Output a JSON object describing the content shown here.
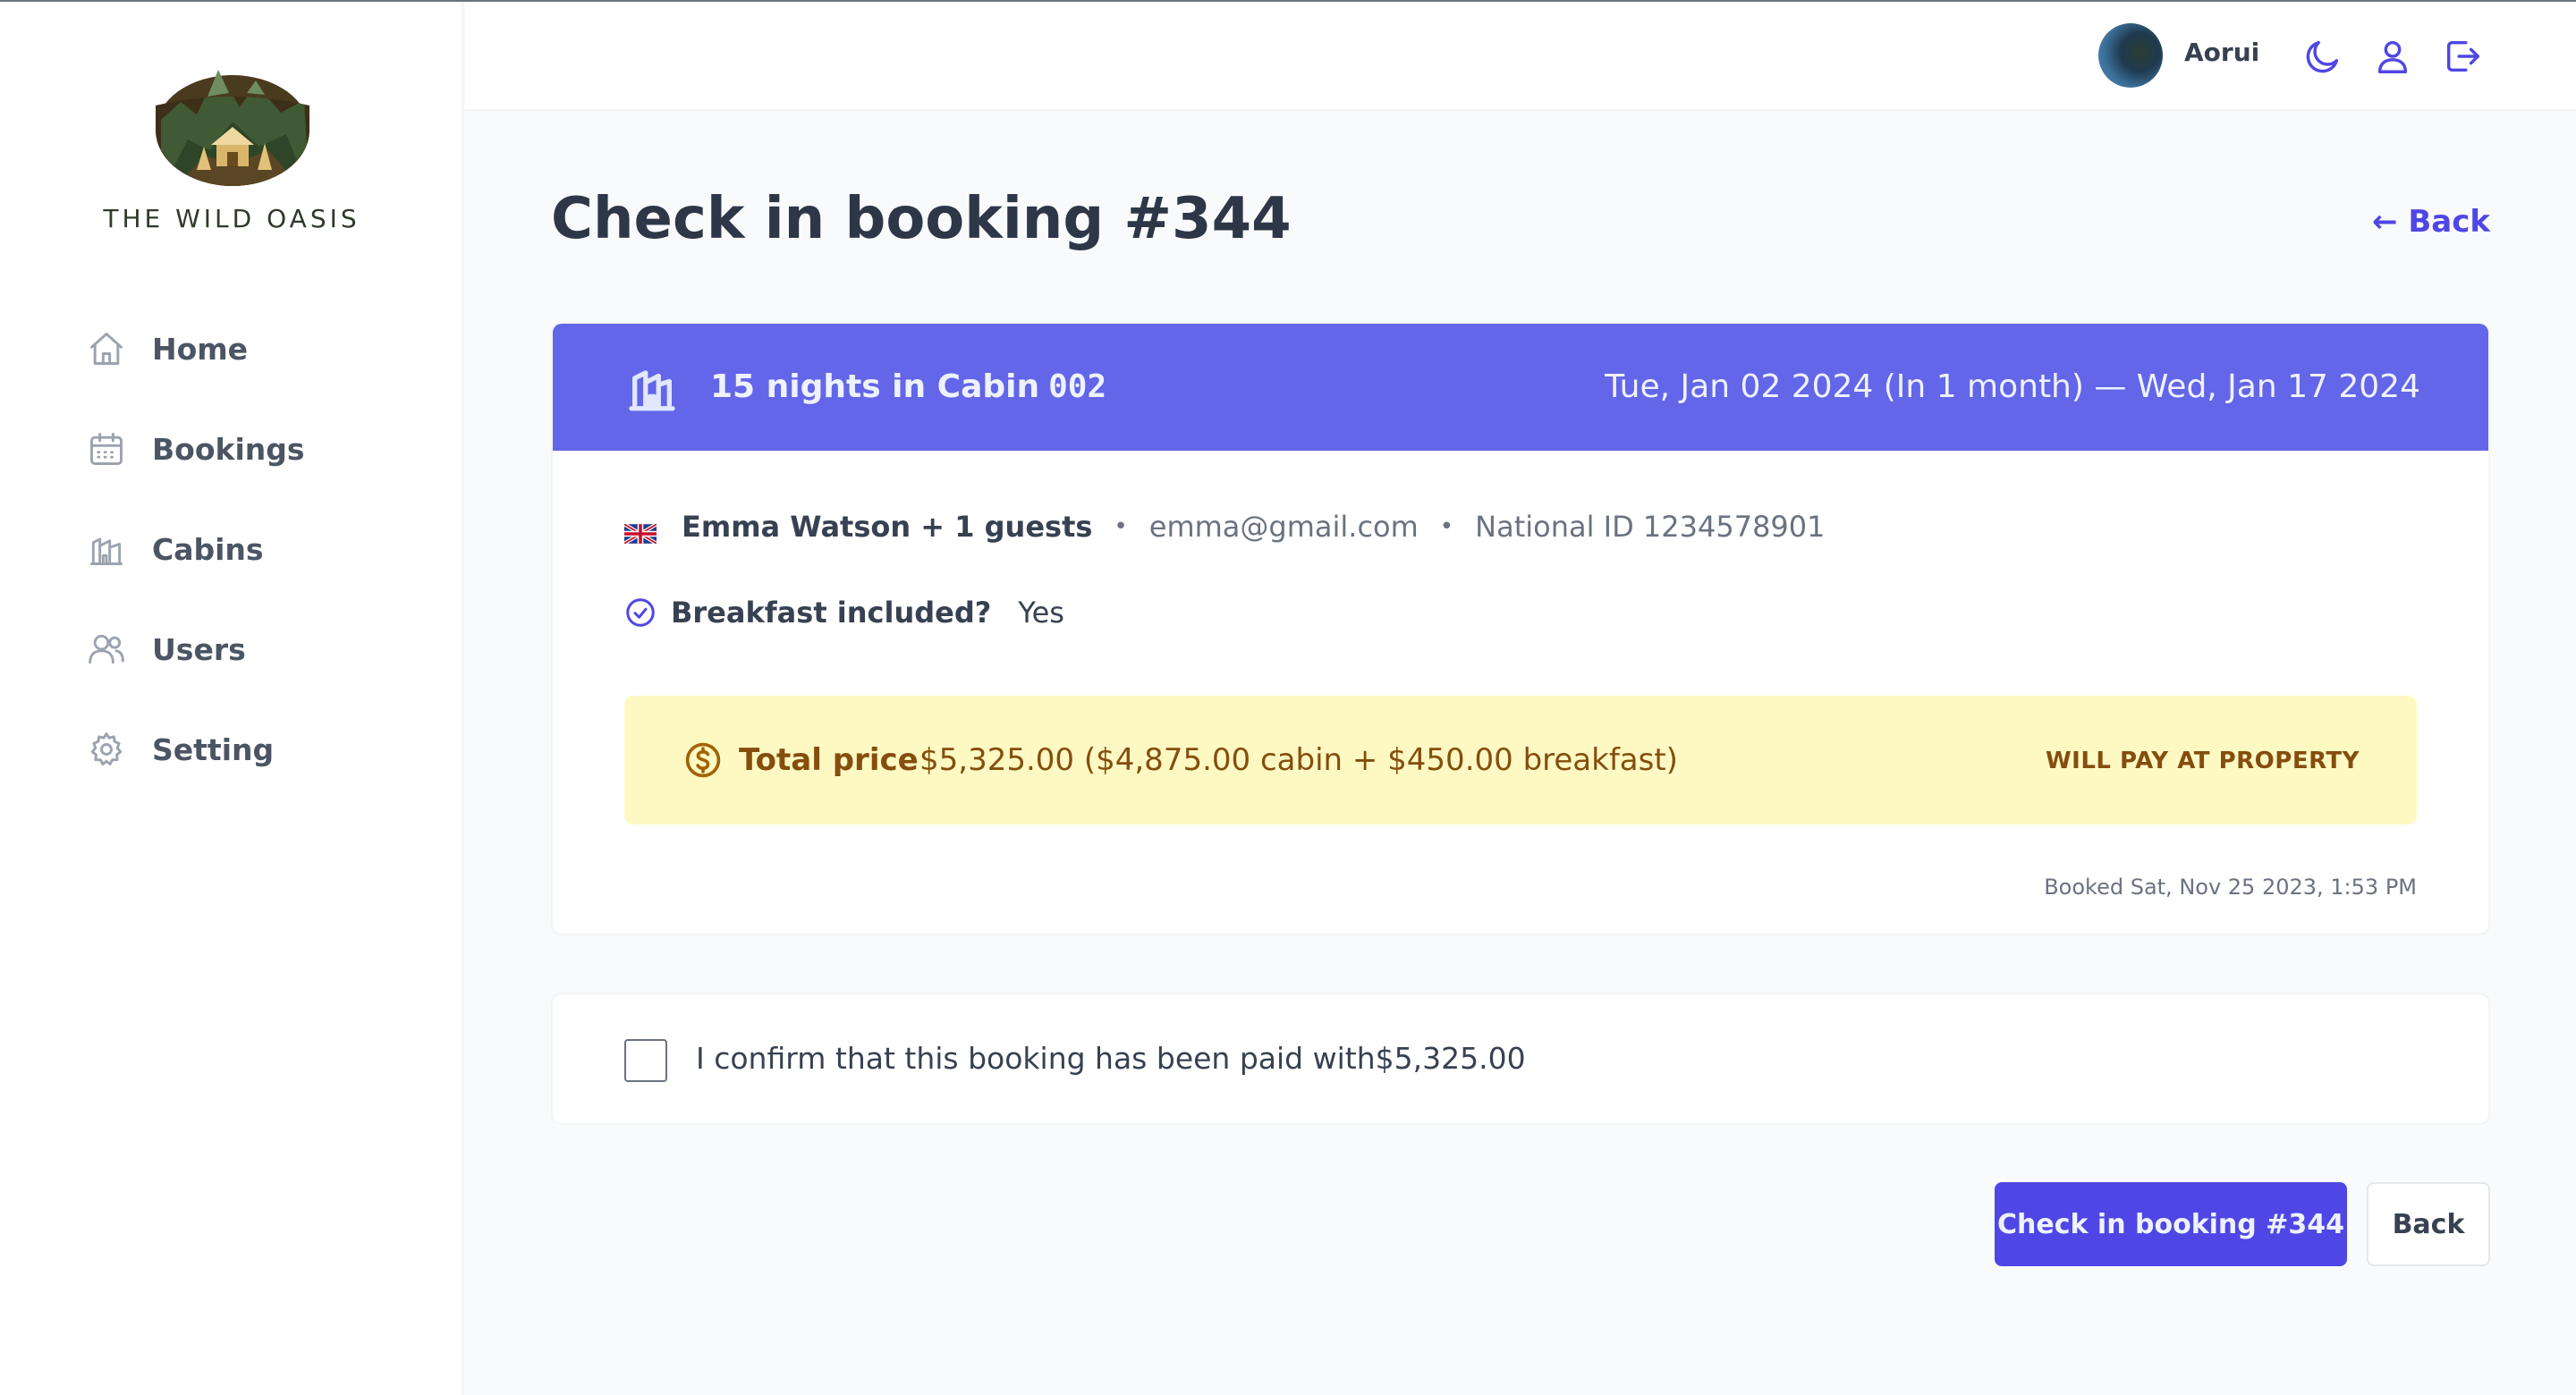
{
  "app": {
    "brand": "THE WILD OASIS"
  },
  "sidebar": {
    "items": [
      {
        "label": "Home",
        "icon": "home-icon"
      },
      {
        "label": "Bookings",
        "icon": "calendar-icon"
      },
      {
        "label": "Cabins",
        "icon": "cabin-icon"
      },
      {
        "label": "Users",
        "icon": "users-icon"
      },
      {
        "label": "Setting",
        "icon": "gear-icon"
      }
    ]
  },
  "header": {
    "username": "Aorui",
    "icons": [
      "moon-icon",
      "user-icon",
      "logout-icon"
    ]
  },
  "page": {
    "title": "Check in booking #344",
    "back_link": "← Back"
  },
  "booking": {
    "nights": "15 nights in Cabin",
    "cabin": "002",
    "dates": "Tue, Jan 02 2024 (In 1 month) — Wed, Jan 17 2024",
    "guest": "Emma Watson + 1 guests",
    "separator": "•",
    "email": "emma@gmail.com",
    "national_id": "National ID 1234578901",
    "breakfast_label": "Breakfast included?",
    "breakfast_value": "Yes",
    "price_label": "Total price",
    "price_value": "$5,325.00 ($4,875.00 cabin + $450.00 breakfast)",
    "payment_status": "WILL PAY AT PROPERTY",
    "booked_at": "Booked Sat, Nov 25 2023, 1:53 PM"
  },
  "confirm": {
    "text": "I confirm that this booking has been paid with$5,325.00",
    "checked": false
  },
  "actions": {
    "checkin_label": "Check in booking #344",
    "back_label": "Back"
  },
  "colors": {
    "accent": "#4f46e5",
    "banner": "#6366e8",
    "price_bg": "#fef9c3",
    "price_text": "#854d0e"
  }
}
